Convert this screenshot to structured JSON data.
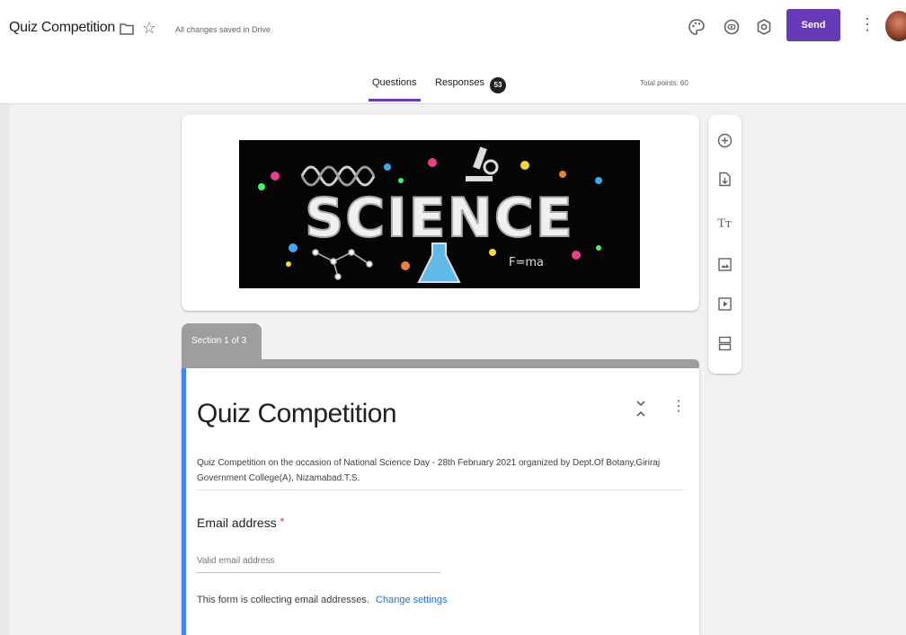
{
  "header": {
    "doc_title": "Quiz Competition",
    "saved_status": "All changes saved in Drive",
    "send_label": "Send",
    "icons": [
      "folder-icon",
      "star-icon",
      "palette-icon",
      "preview-eye-icon",
      "settings-gear-icon",
      "more-vert-icon",
      "avatar"
    ],
    "accent_color": "#673ab7"
  },
  "tabs": {
    "questions_label": "Questions",
    "responses_label": "Responses",
    "responses_count": "53",
    "total_points": "Total points: 60"
  },
  "banner": {
    "word": "SCIENCE"
  },
  "side_toolbar": {
    "tools": [
      "add-question-icon",
      "import-questions-icon",
      "add-title-icon",
      "add-image-icon",
      "add-video-icon",
      "add-section-icon"
    ]
  },
  "section": {
    "tab_label": "Section 1 of 3"
  },
  "form": {
    "title": "Quiz Competition",
    "description": "Quiz Competition on the occasion of National Science Day - 28th  February 2021 organized by Dept.Of Botany,Giriraj Government College(A), Nizamabad.T.S.",
    "email_label": "Email address",
    "required_mark": "*",
    "email_placeholder": "Valid email address",
    "collect_notice": "This form is collecting email addresses.",
    "change_settings": "Change settings",
    "section_accent": "#4285f4"
  }
}
